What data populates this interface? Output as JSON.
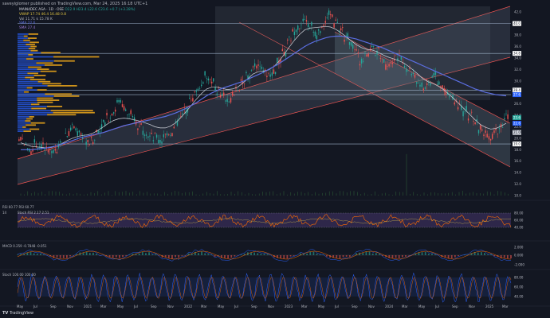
{
  "header": {
    "publisher_line": "saveyiglomer published on TradingView.com, Mar 24, 2025 16:18 UTC+1"
  },
  "footer": {
    "brand": "TradingView"
  },
  "legend": {
    "symbol": "MAIN4DEC ASA · 1D · OSE",
    "ohlc": "O22.9 H23.4 L22.6 C23.6 +0.7 (+3.28%)",
    "vwap": "VWAP  17.74 46.4  16.48 0.8",
    "vol": "Vol  11.71 k  15.78 K",
    "sma": "SMA  22.6",
    "sma2": "SMA  27.4"
  },
  "colors": {
    "background": "#131722",
    "up": "#26a69a",
    "down": "#ef5350",
    "sma_fast": "#d1d4dc",
    "sma_slow": "#5b6ee1",
    "volume_profile_up": "#2962ff",
    "volume_profile_down": "#f0a81a",
    "channel_fill": "#3b4252",
    "rsi_line": "#ff6d00",
    "rsi_band": "#7e57c2",
    "macd_line": "#2962ff",
    "signal_line": "#ff6d00",
    "stoch_k": "#2962ff",
    "stoch_d": "#ff6d00"
  },
  "panes": {
    "rsi": {
      "label": "RSI  60.77  RSI 60.77",
      "label2": "14",
      "label3": "Stoch RSI  2.17 2.51"
    },
    "macd": {
      "label": "MACD  0.259  -0.7848  -0.051"
    },
    "stoch": {
      "label": "Stoch  100.00  100.00"
    }
  },
  "chart_data": {
    "type": "line",
    "x_ticks": [
      "May",
      "Jul",
      "Sep",
      "Nov",
      "2021",
      "Mar",
      "May",
      "Jul",
      "Sep",
      "Nov",
      "2022",
      "Mar",
      "May",
      "Jul",
      "Sep",
      "Nov",
      "2023",
      "Mar",
      "May",
      "Jul",
      "Sep",
      "Nov",
      "2024",
      "Mar",
      "May",
      "Jul",
      "Sep",
      "Nov",
      "2025",
      "Mar"
    ],
    "price_axis_ticks": [
      "42.0",
      "40.0",
      "38.0",
      "36.0",
      "34.0",
      "32.0",
      "30.0",
      "28.0",
      "26.0",
      "24.0",
      "22.0",
      "20.0",
      "18.0",
      "16.0",
      "14.0",
      "12.0",
      "10.0"
    ],
    "ylim": [
      10,
      43
    ],
    "horizontal_levels": [
      40.0,
      34.8,
      28.4,
      27.6,
      19.0
    ],
    "price_labels": [
      {
        "value": "40.0",
        "color": "#ffffff"
      },
      {
        "value": "34.8",
        "color": "#ffffff"
      },
      {
        "value": "28.4",
        "color": "#ffffff"
      },
      {
        "value": "27.6",
        "color": "#2962ff"
      },
      {
        "value": "22.6",
        "color": "#2962ff"
      },
      {
        "value": "23.6",
        "color": "#26a69a"
      },
      {
        "value": "21.00",
        "color": "#131722"
      },
      {
        "value": "19.0",
        "color": "#ffffff"
      }
    ],
    "price_series": [
      19.5,
      18.8,
      18.2,
      19.1,
      18.6,
      18.0,
      17.6,
      18.3,
      19.2,
      20.6,
      21.8,
      21.0,
      20.2,
      19.4,
      19.9,
      21.3,
      22.5,
      23.8,
      24.9,
      26.2,
      25.4,
      24.1,
      23.0,
      22.2,
      21.5,
      20.8,
      20.1,
      19.6,
      20.3,
      21.2,
      22.4,
      23.9,
      25.2,
      26.8,
      28.3,
      29.5,
      30.8,
      29.7,
      28.4,
      27.2,
      26.5,
      27.3,
      28.6,
      29.8,
      30.9,
      32.4,
      33.1,
      31.8,
      30.6,
      31.9,
      33.4,
      35.2,
      37.0,
      38.6,
      39.8,
      40.9,
      39.5,
      38.2,
      39.1,
      40.4,
      41.6,
      40.2,
      38.7,
      37.5,
      36.3,
      35.0,
      33.6,
      34.8,
      36.1,
      35.2,
      33.9,
      32.8,
      33.5,
      34.6,
      33.3,
      32.1,
      31.0,
      29.8,
      28.9,
      29.6,
      30.8,
      29.7,
      28.5,
      27.4,
      26.6,
      25.9,
      24.8,
      23.9,
      22.7,
      21.6,
      20.8,
      20.2,
      21.1,
      22.3,
      23.6
    ],
    "sma_fast": [
      19.2,
      18.9,
      18.6,
      18.5,
      18.4,
      18.3,
      18.4,
      18.7,
      19.1,
      19.6,
      20.0,
      20.3,
      20.5,
      20.6,
      20.9,
      21.4,
      22.0,
      22.6,
      23.1,
      23.4,
      23.5,
      23.4,
      23.2,
      23.0,
      22.7,
      22.4,
      22.0,
      21.8,
      21.8,
      22.1,
      22.7,
      23.6,
      24.6,
      25.7,
      26.8,
      27.8,
      28.6,
      28.9,
      28.9,
      28.7,
      28.5,
      28.6,
      28.9,
      29.6,
      30.4,
      31.2,
      31.6,
      31.7,
      31.9,
      32.5,
      33.4,
      34.6,
      35.9,
      37.1,
      38.1,
      38.9,
      39.2,
      39.3,
      39.4,
      39.5,
      39.4,
      39.0,
      38.4,
      37.7,
      37.0,
      36.3,
      35.8,
      35.5,
      35.4,
      35.1,
      34.6,
      34.2,
      33.9,
      33.6,
      33.2,
      32.6,
      31.9,
      31.1,
      30.3,
      29.8,
      29.5,
      29.0,
      28.4,
      27.6,
      26.8,
      25.9,
      25.0,
      24.1,
      23.2,
      22.4,
      21.9,
      21.6,
      21.7,
      22.1,
      22.6
    ],
    "sma_slow": [
      18.0,
      18.0,
      18.0,
      18.1,
      18.2,
      18.3,
      18.5,
      18.7,
      19.0,
      19.3,
      19.6,
      19.9,
      20.2,
      20.4,
      20.6,
      20.8,
      21.0,
      21.3,
      21.6,
      21.9,
      22.2,
      22.4,
      22.6,
      22.8,
      23.0,
      23.2,
      23.4,
      23.6,
      23.8,
      24.1,
      24.4,
      24.8,
      25.2,
      25.7,
      26.2,
      26.8,
      27.4,
      27.9,
      28.3,
      28.7,
      29.0,
      29.3,
      29.6,
      29.9,
      30.3,
      30.7,
      31.1,
      31.5,
      32.0,
      32.5,
      33.0,
      33.6,
      34.2,
      34.8,
      35.4,
      36.0,
      36.5,
      36.9,
      37.2,
      37.5,
      37.7,
      37.8,
      37.8,
      37.7,
      37.5,
      37.3,
      37.0,
      36.7,
      36.4,
      36.1,
      35.8,
      35.4,
      35.0,
      34.6,
      34.2,
      33.8,
      33.4,
      33.0,
      32.6,
      32.2,
      31.8,
      31.4,
      31.0,
      30.6,
      30.2,
      29.8,
      29.4,
      29.0,
      28.6,
      28.3,
      28.0,
      27.8,
      27.6,
      27.5,
      27.4
    ],
    "rsi": {
      "ylim": [
        0,
        100
      ],
      "ticks": [
        "80.00",
        "60.00",
        "40.00"
      ],
      "last": 60.77
    },
    "macd": {
      "ticks": [
        "2.000",
        "0.000",
        "-2.000"
      ],
      "last": 0.259
    },
    "stoch": {
      "ylim": [
        0,
        100
      ],
      "ticks": [
        "80.00",
        "60.00",
        "40.00"
      ],
      "last": 100.0
    }
  }
}
